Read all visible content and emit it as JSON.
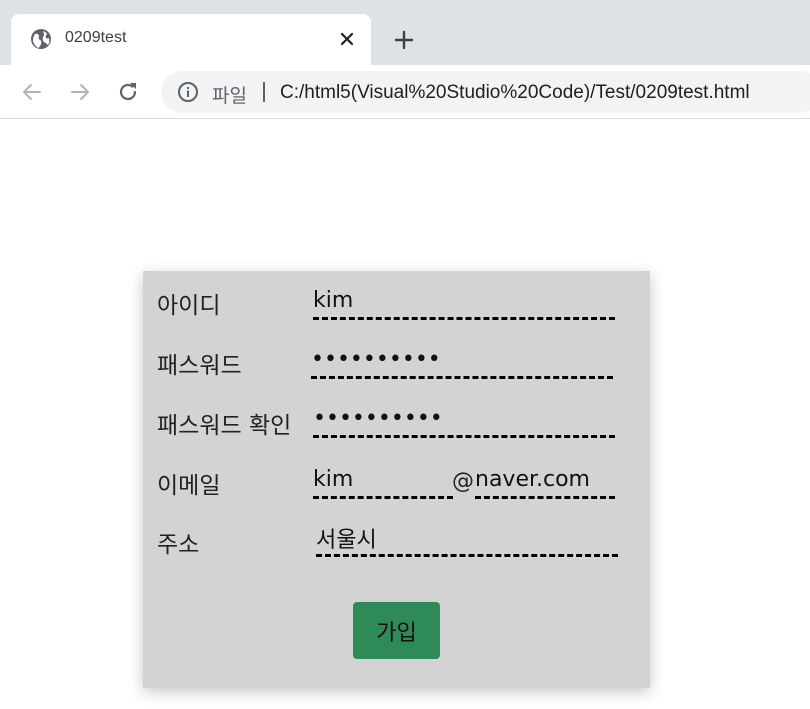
{
  "browser": {
    "tab": {
      "title": "0209test",
      "favicon": "globe-icon",
      "close_icon": "close-icon"
    },
    "new_tab_icon": "plus-icon",
    "nav": {
      "back_icon": "arrow-left-icon",
      "forward_icon": "arrow-right-icon",
      "reload_icon": "reload-icon"
    },
    "omnibox": {
      "info_icon": "info-icon",
      "scheme_label": "파일",
      "url": "C:/html5(Visual%20Studio%20Code)/Test/0209test.html"
    }
  },
  "form": {
    "background": "#d3d3d3",
    "fields": {
      "id": {
        "label": "아이디",
        "value": "kim"
      },
      "password": {
        "label": "패스워드",
        "value": "••••••••••"
      },
      "password_confirm": {
        "label": "패스워드 확인",
        "value": "••••••••••"
      },
      "email": {
        "label": "이메일",
        "local_value": "kim",
        "at": "@",
        "domain_value": "naver.com"
      },
      "address": {
        "label": "주소",
        "value": "서울시"
      }
    },
    "submit": {
      "label": "가입",
      "color": "#2e8b57"
    }
  }
}
